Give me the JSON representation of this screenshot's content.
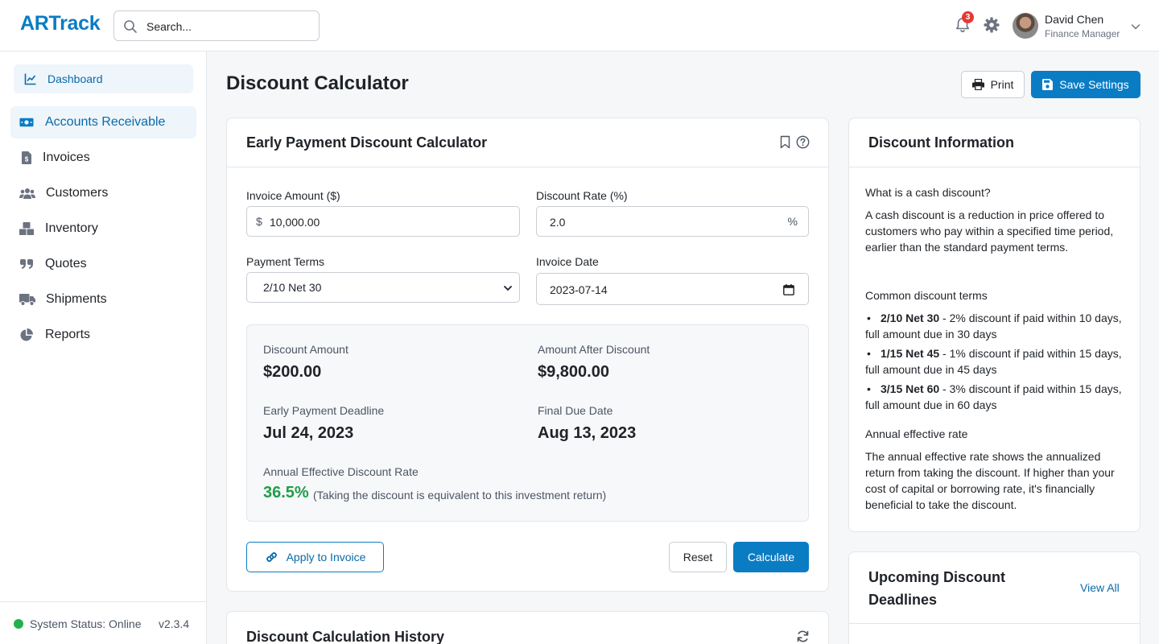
{
  "app": {
    "logo": "ARTrack"
  },
  "search": {
    "placeholder": "Search..."
  },
  "header": {
    "notifications_count": "3",
    "user_name": "David Chen",
    "user_role": "Finance Manager"
  },
  "sidebar": {
    "items": [
      {
        "label": "Dashboard",
        "icon": "chart-line-icon"
      },
      {
        "label": "Accounts Receivable",
        "icon": "money-bill-icon"
      },
      {
        "label": "Invoices",
        "icon": "file-invoice-icon"
      },
      {
        "label": "Customers",
        "icon": "users-icon"
      },
      {
        "label": "Inventory",
        "icon": "boxes-icon"
      },
      {
        "label": "Quotes",
        "icon": "quote-icon"
      },
      {
        "label": "Shipments",
        "icon": "truck-icon"
      },
      {
        "label": "Reports",
        "icon": "pie-chart-icon"
      }
    ],
    "status": "System Status: Online",
    "version": "v2.3.4"
  },
  "page": {
    "title": "Discount Calculator",
    "print_label": "Print",
    "save_label": "Save Settings"
  },
  "calculator": {
    "title": "Early Payment Discount Calculator",
    "invoice_amount_label": "Invoice Amount ($)",
    "invoice_amount_prefix": "$",
    "invoice_amount_value": "10,000.00",
    "discount_rate_label": "Discount Rate (%)",
    "discount_rate_value": "2.0",
    "discount_rate_suffix": "%",
    "payment_terms_label": "Payment Terms",
    "payment_terms_value": "2/10 Net 30",
    "invoice_date_label": "Invoice Date",
    "invoice_date_value": "2023-07-14",
    "results": {
      "discount_amount_label": "Discount Amount",
      "discount_amount": "$200.00",
      "after_discount_label": "Amount After Discount",
      "after_discount": "$9,800.00",
      "deadline_label": "Early Payment Deadline",
      "deadline": "Jul 24, 2023",
      "final_due_label": "Final Due Date",
      "final_due": "Aug 13, 2023",
      "annual_rate_label": "Annual Effective Discount Rate",
      "annual_rate": "36.5%",
      "annual_rate_note": "(Taking the discount is equivalent to this investment return)"
    },
    "apply_label": "Apply to Invoice",
    "reset_label": "Reset",
    "calculate_label": "Calculate"
  },
  "history": {
    "title": "Discount Calculation History"
  },
  "info": {
    "title": "Discount Information",
    "q1": "What is a cash discount?",
    "a1": "A cash discount is a reduction in price offered to customers who pay within a specified time period, earlier than the standard payment terms.",
    "q2": "Common discount terms",
    "terms": [
      {
        "name": "2/10 Net 30",
        "desc": " - 2% discount if paid within 10 days, full amount due in 30 days"
      },
      {
        "name": "1/15 Net 45",
        "desc": " - 1% discount if paid within 15 days, full amount due in 45 days"
      },
      {
        "name": "3/15 Net 60",
        "desc": " - 3% discount if paid within 15 days, full amount due in 60 days"
      }
    ],
    "q3": "Annual effective rate",
    "a3": "The annual effective rate shows the annualized return from taking the discount. If higher than your cost of capital or borrowing rate, it's financially beneficial to take the discount."
  },
  "deadlines": {
    "title": "Upcoming Discount Deadlines",
    "view_all": "View All"
  },
  "colors": {
    "brand": "#0a7cc4",
    "success": "#1e9e47",
    "danger": "#e53935",
    "active_bg": "#eef5fb"
  }
}
